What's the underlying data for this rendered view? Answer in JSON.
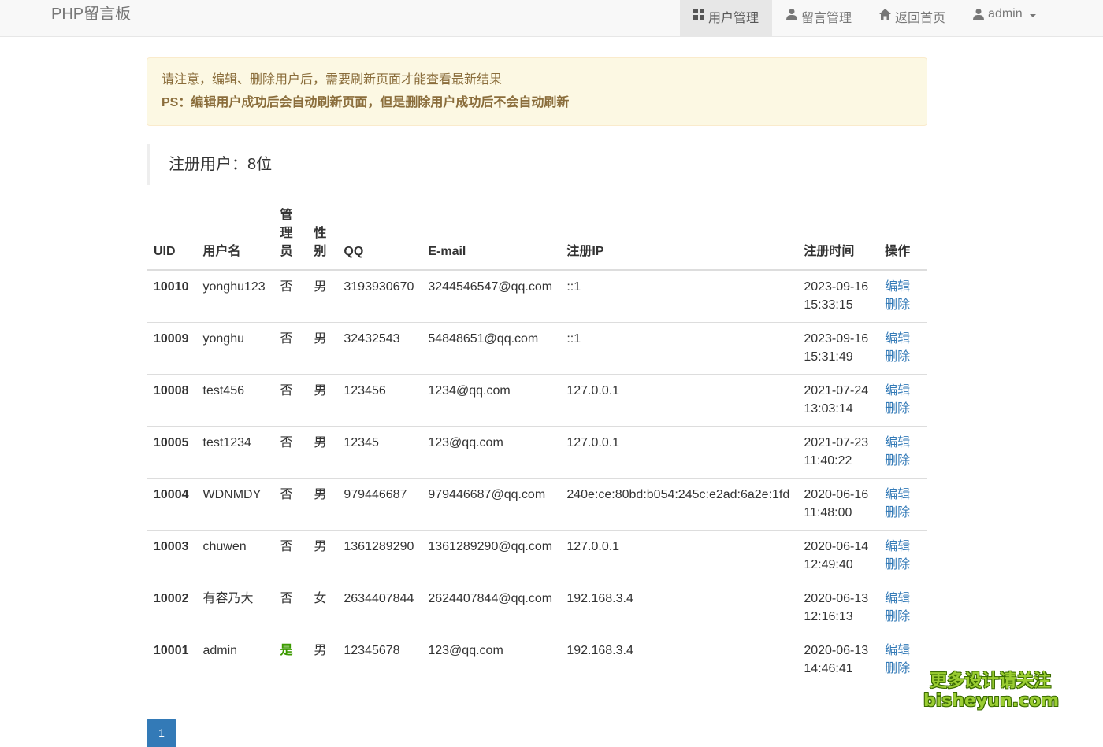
{
  "brand": "PHP留言板",
  "nav": {
    "user_manage": "用户管理",
    "message_manage": "留言管理",
    "home": "返回首页",
    "user": "admin"
  },
  "alert": {
    "line1": "请注意，编辑、删除用户后，需要刷新页面才能查看最新结果",
    "line2": "PS：编辑用户成功后会自动刷新页面，但是删除用户成功后不会自动刷新"
  },
  "summary": "注册用户：8位",
  "table": {
    "headers": {
      "uid": "UID",
      "username": "用户名",
      "admin": [
        "管",
        "理",
        "员"
      ],
      "gender": [
        "性",
        "别"
      ],
      "qq": "QQ",
      "email": "E-mail",
      "ip": "注册IP",
      "time": "注册时间",
      "action": "操作"
    },
    "rows": [
      {
        "uid": "10010",
        "username": "yonghu123",
        "admin": "否",
        "gender": "男",
        "qq": "3193930670",
        "email": "3244546547@qq.com",
        "ip": "::1",
        "date": "2023-09-16",
        "time": "15:33:15"
      },
      {
        "uid": "10009",
        "username": "yonghu",
        "admin": "否",
        "gender": "男",
        "qq": "32432543",
        "email": "54848651@qq.com",
        "ip": "::1",
        "date": "2023-09-16",
        "time": "15:31:49"
      },
      {
        "uid": "10008",
        "username": "test456",
        "admin": "否",
        "gender": "男",
        "qq": "123456",
        "email": "1234@qq.com",
        "ip": "127.0.0.1",
        "date": "2021-07-24",
        "time": "13:03:14"
      },
      {
        "uid": "10005",
        "username": "test1234",
        "admin": "否",
        "gender": "男",
        "qq": "12345",
        "email": "123@qq.com",
        "ip": "127.0.0.1",
        "date": "2021-07-23",
        "time": "11:40:22"
      },
      {
        "uid": "10004",
        "username": "WDNMDY",
        "admin": "否",
        "gender": "男",
        "qq": "979446687",
        "email": "979446687@qq.com",
        "ip": "240e:ce:80bd:b054:245c:e2ad:6a2e:1fd",
        "date": "2020-06-16",
        "time": "11:48:00"
      },
      {
        "uid": "10003",
        "username": "chuwen",
        "admin": "否",
        "gender": "男",
        "qq": "1361289290",
        "email": "1361289290@qq.com",
        "ip": "127.0.0.1",
        "date": "2020-06-14",
        "time": "12:49:40"
      },
      {
        "uid": "10002",
        "username": "有容乃大",
        "admin": "否",
        "gender": "女",
        "qq": "2634407844",
        "email": "2624407844@qq.com",
        "ip": "192.168.3.4",
        "date": "2020-06-13",
        "time": "12:16:13"
      },
      {
        "uid": "10001",
        "username": "admin",
        "admin": "是",
        "gender": "男",
        "qq": "12345678",
        "email": "123@qq.com",
        "ip": "192.168.3.4",
        "date": "2020-06-13",
        "time": "14:46:41"
      }
    ],
    "edit_label": "编辑",
    "delete_label": "删除"
  },
  "pagination": {
    "current": "1"
  },
  "watermark": {
    "line1": "更多设计请关注",
    "line2": "bisheyun.com"
  }
}
